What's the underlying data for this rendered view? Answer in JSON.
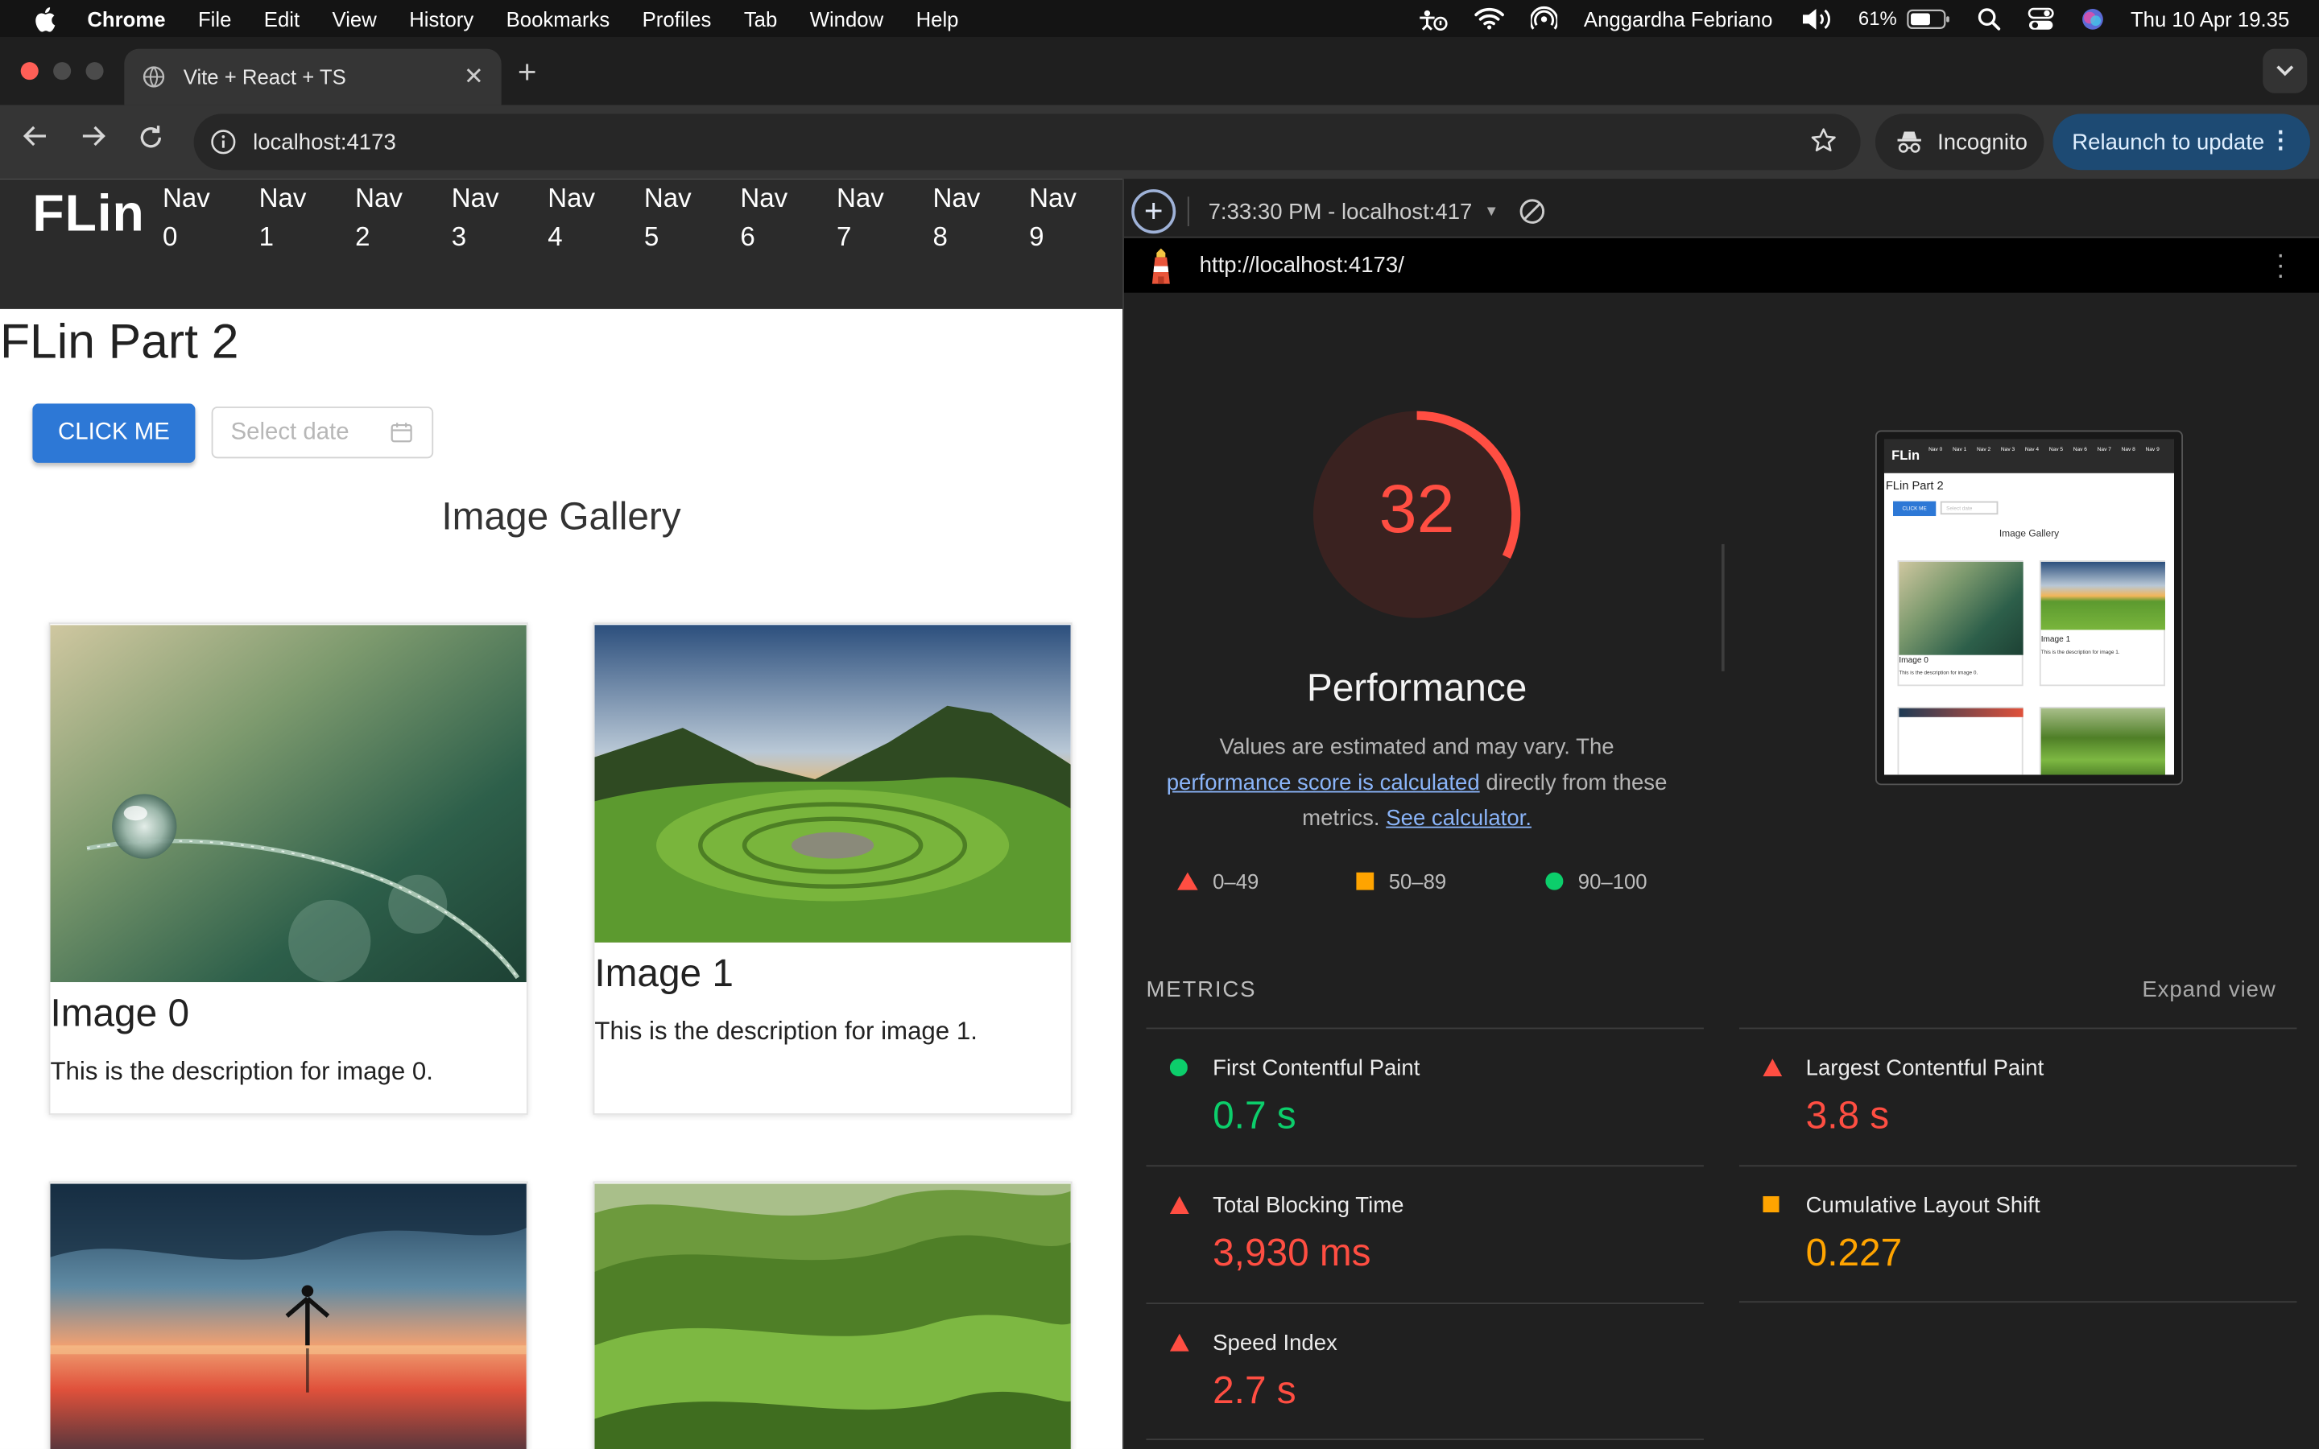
{
  "menubar": {
    "app": "Chrome",
    "menus": [
      "File",
      "Edit",
      "View",
      "History",
      "Bookmarks",
      "Profiles",
      "Tab",
      "Window",
      "Help"
    ],
    "user": "Anggardha Febriano",
    "battery": "61%",
    "datetime": "Thu 10 Apr  19.35"
  },
  "browser": {
    "tab_title": "Vite + React + TS",
    "url": "localhost:4173",
    "incognito_label": "Incognito",
    "relaunch_label": "Relaunch to update"
  },
  "page": {
    "logo": "FLin",
    "nav": [
      {
        "line1": "Nav",
        "line2": "0"
      },
      {
        "line1": "Nav",
        "line2": "1"
      },
      {
        "line1": "Nav",
        "line2": "2"
      },
      {
        "line1": "Nav",
        "line2": "3"
      },
      {
        "line1": "Nav",
        "line2": "4"
      },
      {
        "line1": "Nav",
        "line2": "5"
      },
      {
        "line1": "Nav",
        "line2": "6"
      },
      {
        "line1": "Nav",
        "line2": "7"
      },
      {
        "line1": "Nav",
        "line2": "8"
      },
      {
        "line1": "Nav",
        "line2": "9"
      }
    ],
    "heading": "FLin Part 2",
    "button_label": "CLICK ME",
    "date_placeholder": "Select date",
    "gallery_title": "Image Gallery",
    "cards": [
      {
        "title": "Image 0",
        "description": "This is the description for image 0."
      },
      {
        "title": "Image 1",
        "description": "This is the description for image 1."
      }
    ]
  },
  "lighthouse": {
    "report_label": "7:33:30 PM - localhost:417",
    "report_url": "http://localhost:4173/",
    "score": 32,
    "score_fraction": 0.32,
    "category": "Performance",
    "desc_before": "Values are estimated and may vary. The ",
    "desc_link1": "performance score is calculated",
    "desc_middle": " directly from these metrics. ",
    "desc_link2": "See calculator.",
    "legend": [
      {
        "symbol": "triangle-red",
        "range": "0–49"
      },
      {
        "symbol": "square-orange",
        "range": "50–89"
      },
      {
        "symbol": "circle-green",
        "range": "90–100"
      }
    ],
    "metrics_heading": "METRICS",
    "expand_label": "Expand view",
    "metrics": [
      {
        "label": "First Contentful Paint",
        "value": "0.7 s",
        "status": "pass"
      },
      {
        "label": "Largest Contentful Paint",
        "value": "3.8 s",
        "status": "fail"
      },
      {
        "label": "Total Blocking Time",
        "value": "3,930 ms",
        "status": "fail"
      },
      {
        "label": "Cumulative Layout Shift",
        "value": "0.227",
        "status": "average"
      },
      {
        "label": "Speed Index",
        "value": "2.7 s",
        "status": "fail"
      }
    ],
    "thumbnail": {
      "logo": "FLin",
      "heading": "FLin Part 2",
      "button": "CLICK ME",
      "date": "Select date",
      "gallery": "Image Gallery",
      "card0_title": "Image 0",
      "card0_desc": "This is the description for image 0.",
      "card1_title": "Image 1",
      "card1_desc": "This is the description for image 1."
    }
  },
  "colors": {
    "fail": "#ff4e42",
    "average": "#ffa400",
    "pass": "#0cce6b",
    "accent_button": "#2d78d6"
  }
}
